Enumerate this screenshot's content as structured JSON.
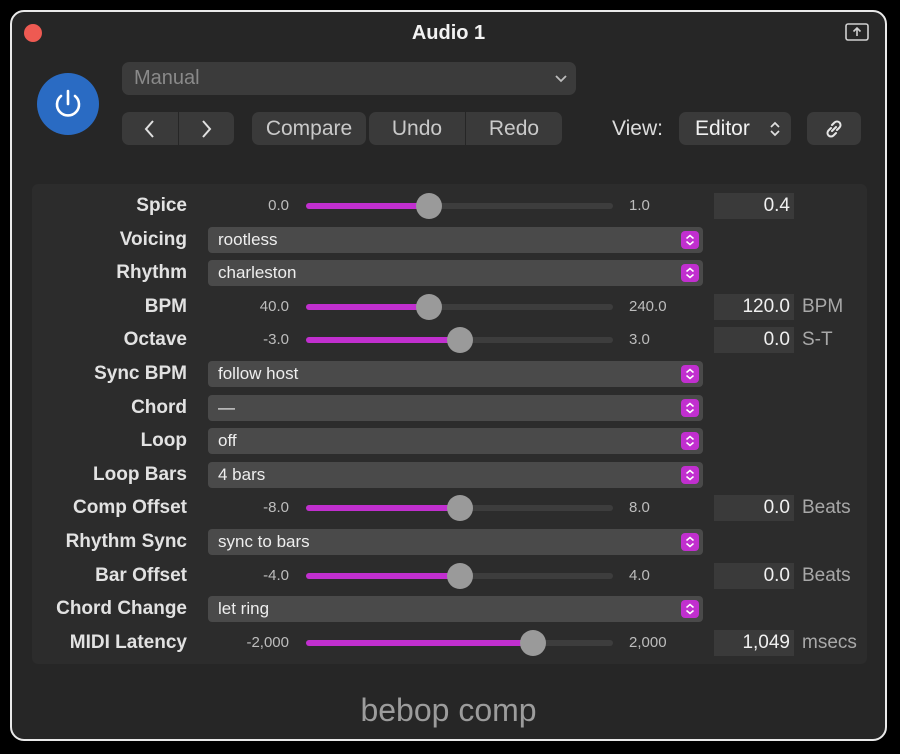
{
  "window": {
    "title": "Audio 1"
  },
  "header": {
    "preset": "Manual",
    "compare_label": "Compare",
    "undo_label": "Undo",
    "redo_label": "Redo",
    "view_label": "View:",
    "view_value": "Editor"
  },
  "params": [
    {
      "label": "Spice",
      "type": "slider",
      "min": "0.0",
      "max": "1.0",
      "value": "0.4",
      "unit": "",
      "fraction": 0.4
    },
    {
      "label": "Voicing",
      "type": "select",
      "value": "rootless"
    },
    {
      "label": "Rhythm",
      "type": "select",
      "value": "charleston"
    },
    {
      "label": "BPM",
      "type": "slider",
      "min": "40.0",
      "max": "240.0",
      "value": "120.0",
      "unit": "BPM",
      "fraction": 0.4
    },
    {
      "label": "Octave",
      "type": "slider",
      "min": "-3.0",
      "max": "3.0",
      "value": "0.0",
      "unit": "S-T",
      "fraction": 0.5
    },
    {
      "label": "Sync BPM",
      "type": "select",
      "value": "follow host"
    },
    {
      "label": "Chord",
      "type": "select",
      "value": "—"
    },
    {
      "label": "Loop",
      "type": "select",
      "value": "off"
    },
    {
      "label": "Loop Bars",
      "type": "select",
      "value": "4 bars"
    },
    {
      "label": "Comp Offset",
      "type": "slider",
      "min": "-8.0",
      "max": "8.0",
      "value": "0.0",
      "unit": "Beats",
      "fraction": 0.5
    },
    {
      "label": "Rhythm Sync",
      "type": "select",
      "value": "sync to bars"
    },
    {
      "label": "Bar Offset",
      "type": "slider",
      "min": "-4.0",
      "max": "4.0",
      "value": "0.0",
      "unit": "Beats",
      "fraction": 0.5
    },
    {
      "label": "Chord Change",
      "type": "select",
      "value": "let ring"
    },
    {
      "label": "MIDI Latency",
      "type": "slider",
      "min": "-2,000",
      "max": "2,000",
      "value": "1,049",
      "unit": "msecs",
      "fraction": 0.74
    }
  ],
  "footer": {
    "plugin_name": "bebop comp"
  },
  "colors": {
    "accent": "#c12fcf",
    "power": "#2a6bc3"
  },
  "icons": [
    "close-icon",
    "share-icon",
    "power-icon",
    "chevron-down-icon",
    "back-icon",
    "forward-icon",
    "updown-icon",
    "link-icon",
    "stepper-icon"
  ]
}
